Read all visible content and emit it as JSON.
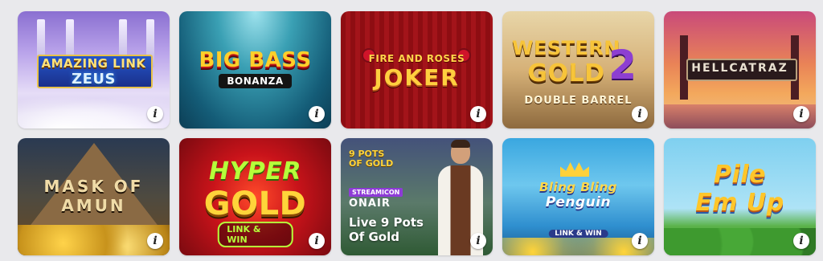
{
  "games": [
    {
      "id": "amazing-link-zeus",
      "line1": "AMAZING LINK",
      "line2": "ZEUS"
    },
    {
      "id": "big-bass-bonanza",
      "line1": "BIG BASS",
      "line2": "BONANZA"
    },
    {
      "id": "fire-and-roses-joker",
      "line1": "FIRE AND ROSES",
      "line2": "JOKER"
    },
    {
      "id": "western-gold-2",
      "line1": "WESTERN",
      "line2": "GOLD",
      "number": "2",
      "sub": "DOUBLE BARREL"
    },
    {
      "id": "hellcatraz",
      "line1": "HELLCATRAZ"
    },
    {
      "id": "mask-of-amun",
      "line1": "MASK OF",
      "line2": "AMUN"
    },
    {
      "id": "hyper-gold",
      "line1": "HYPER",
      "line2": "GOLD",
      "badge": "LINK & WIN"
    },
    {
      "id": "live-9-pots-of-gold",
      "small1": "9 POTS",
      "small2": "OF GOLD",
      "stream": "STREAMICON",
      "onair": "ONAIR",
      "line1": "Live 9 Pots",
      "line2": "Of Gold"
    },
    {
      "id": "bling-bling-penguin",
      "line1": "Bling Bling",
      "line2": "Penguin",
      "badge": "LINK & WIN"
    },
    {
      "id": "pile-em-up",
      "line1": "Pile",
      "line2": "Em Up"
    }
  ],
  "info_label": "i",
  "colors": {
    "page_bg": "#e9e9ec",
    "info_bg": "#ffffff"
  }
}
